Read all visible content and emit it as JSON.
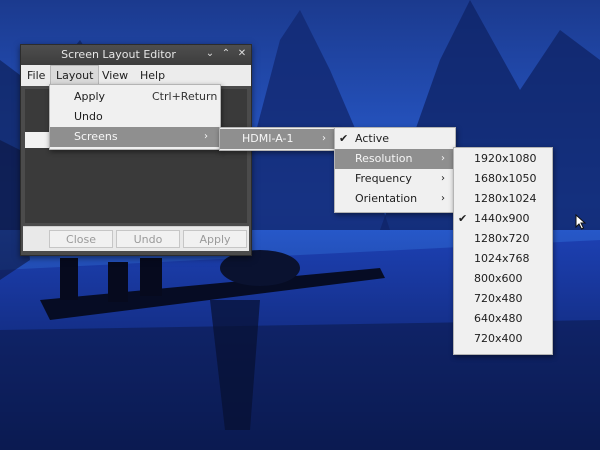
{
  "window": {
    "title": "Screen Layout Editor",
    "controls": {
      "minimize": "⌄",
      "maximize": "⌃",
      "close": "✕"
    }
  },
  "menubar": [
    "File",
    "Layout",
    "View",
    "Help"
  ],
  "layout_menu": {
    "items": [
      {
        "label": "Apply",
        "shortcut": "Ctrl+Return"
      },
      {
        "label": "Undo",
        "shortcut": ""
      },
      {
        "label": "Screens",
        "shortcut": ""
      }
    ]
  },
  "screens_menu": {
    "items": [
      "HDMI-A-1"
    ]
  },
  "output_menu": {
    "items": [
      {
        "label": "Active",
        "checked": true
      },
      {
        "label": "Resolution",
        "checked": false
      },
      {
        "label": "Frequency",
        "checked": false
      },
      {
        "label": "Orientation",
        "checked": false
      }
    ]
  },
  "resolution_menu": {
    "items": [
      "1920x1080",
      "1680x1050",
      "1280x1024",
      "1440x900",
      "1280x720",
      "1024x768",
      "800x600",
      "720x480",
      "640x480",
      "720x400"
    ],
    "selected": "1440x900"
  },
  "buttons": {
    "close": "Close",
    "undo": "Undo",
    "apply": "Apply"
  },
  "icons": {
    "check": "✔",
    "submenu": "›"
  },
  "colors": {
    "menu_bg": "#f0f0f0",
    "highlight": "#8f8f8f",
    "window_dark": "#4b4b4b"
  }
}
